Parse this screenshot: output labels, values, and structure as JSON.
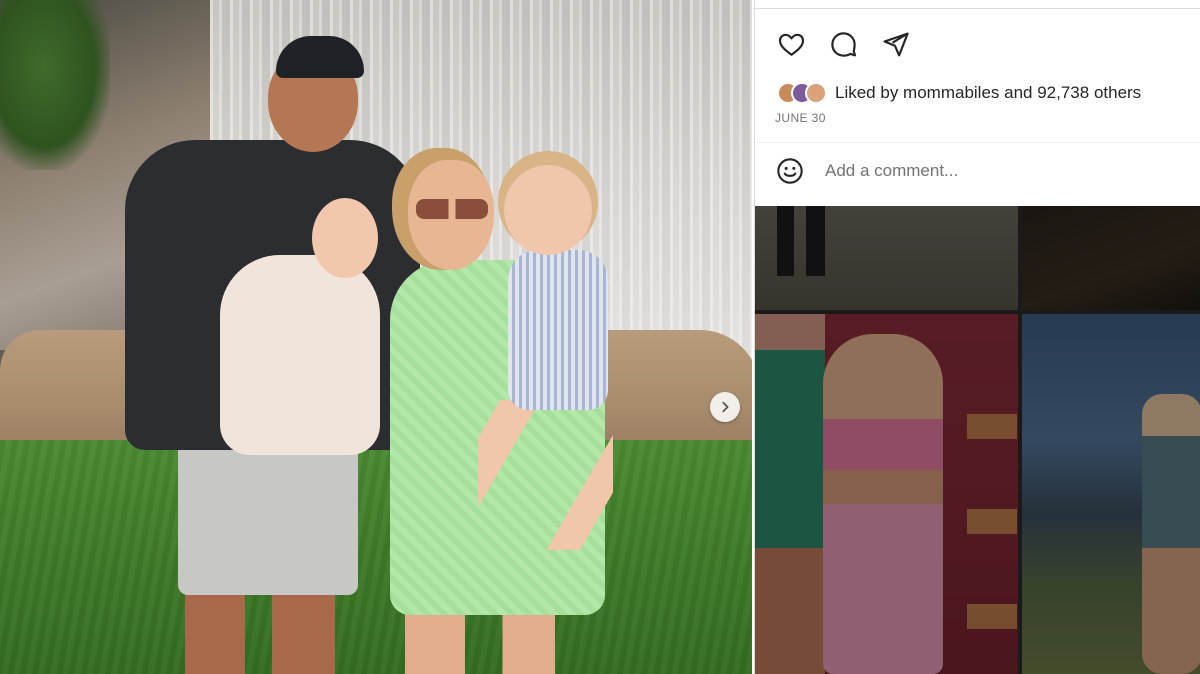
{
  "post": {
    "photo_alt": "Family photo in front of a waterfall",
    "next_icon": "chevron-right-icon"
  },
  "actions": {
    "like_icon": "heart-icon",
    "comment_icon": "comment-bubble-icon",
    "share_icon": "paper-plane-icon"
  },
  "likes": {
    "prefix": "Liked by ",
    "user": "mommabiles",
    "middle": " and ",
    "others": "92,738 others",
    "avatar_colors": [
      "#c98a5a",
      "#7d5a9a",
      "#d9a27a"
    ]
  },
  "date": "JUNE 30",
  "comment": {
    "emoji_icon": "smiley-icon",
    "placeholder": "Add a comment..."
  },
  "colors": {
    "text": "#262626",
    "muted": "#737373",
    "border": "#dbdbdb"
  }
}
